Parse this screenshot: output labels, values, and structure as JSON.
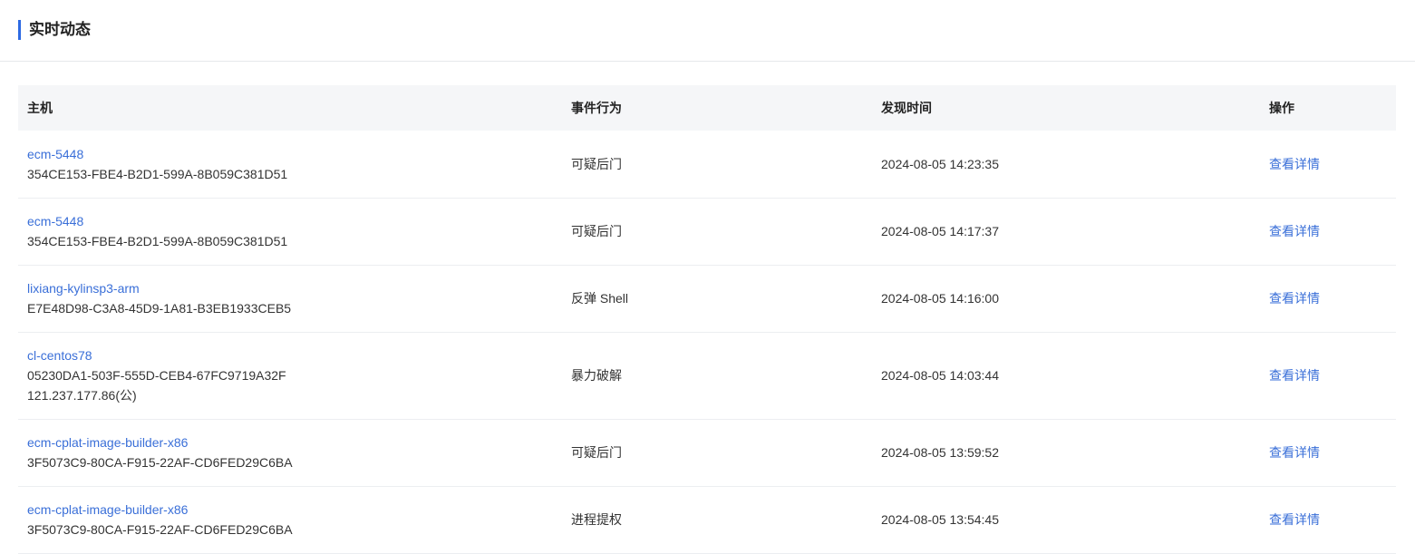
{
  "section": {
    "title": "实时动态"
  },
  "table": {
    "headers": {
      "host": "主机",
      "event": "事件行为",
      "time": "发现时间",
      "action": "操作"
    },
    "rows": [
      {
        "host_name": "ecm-5448",
        "host_id": "354CE153-FBE4-B2D1-599A-8B059C381D51",
        "host_ip": "",
        "event": "可疑后门",
        "time": "2024-08-05 14:23:35",
        "action": "查看详情"
      },
      {
        "host_name": "ecm-5448",
        "host_id": "354CE153-FBE4-B2D1-599A-8B059C381D51",
        "host_ip": "",
        "event": "可疑后门",
        "time": "2024-08-05 14:17:37",
        "action": "查看详情"
      },
      {
        "host_name": "lixiang-kylinsp3-arm",
        "host_id": "E7E48D98-C3A8-45D9-1A81-B3EB1933CEB5",
        "host_ip": "",
        "event": "反弹 Shell",
        "time": "2024-08-05 14:16:00",
        "action": "查看详情"
      },
      {
        "host_name": "cl-centos78",
        "host_id": "05230DA1-503F-555D-CEB4-67FC9719A32F",
        "host_ip": "121.237.177.86(公)",
        "event": "暴力破解",
        "time": "2024-08-05 14:03:44",
        "action": "查看详情"
      },
      {
        "host_name": "ecm-cplat-image-builder-x86",
        "host_id": "3F5073C9-80CA-F915-22AF-CD6FED29C6BA",
        "host_ip": "",
        "event": "可疑后门",
        "time": "2024-08-05 13:59:52",
        "action": "查看详情"
      },
      {
        "host_name": "ecm-cplat-image-builder-x86",
        "host_id": "3F5073C9-80CA-F915-22AF-CD6FED29C6BA",
        "host_ip": "",
        "event": "进程提权",
        "time": "2024-08-05 13:54:45",
        "action": "查看详情"
      }
    ]
  },
  "colors": {
    "accent": "#2d6ae3",
    "link": "#3a6fd8",
    "header_bg": "#f5f6f8"
  }
}
